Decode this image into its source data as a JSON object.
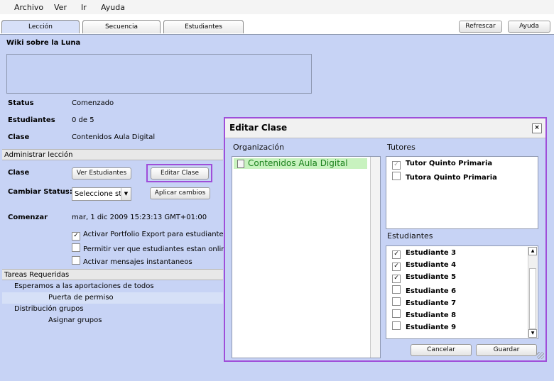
{
  "menu": [
    "Archivo",
    "Ver",
    "Ir",
    "Ayuda"
  ],
  "tabs": [
    "Lección",
    "Secuencia",
    "Estudiantes"
  ],
  "toolbar": {
    "refresh": "Refrescar",
    "help": "Ayuda"
  },
  "lesson": {
    "title": "Wiki sobre la Luna",
    "status_label": "Status",
    "status_value": "Comenzado",
    "students_label": "Estudiantes",
    "students_value": "0 de 5",
    "class_label": "Clase",
    "class_value": "Contenidos Aula Digital"
  },
  "admin": {
    "section": "Administrar lección",
    "class_label": "Clase",
    "view_students": "Ver Estudiantes",
    "edit_class": "Editar Clase",
    "change_status_label": "Cambiar Status:",
    "select_value": "Seleccione st",
    "apply": "Aplicar cambios",
    "start_label": "Comenzar",
    "start_value": "mar, 1 dic 2009 15:23:13 GMT+01:00",
    "options": [
      {
        "label": "Activar Portfolio Export para estudiantes",
        "checked": true
      },
      {
        "label": "Permitir ver que estudiantes estan online",
        "checked": false
      },
      {
        "label": "Activar mensajes instantaneos",
        "checked": false
      }
    ]
  },
  "tasks": {
    "section": "Tareas Requeridas",
    "items": [
      "Esperamos a las aportaciones de todos",
      "Puerta de permiso",
      "Distribución grupos",
      "Asignar grupos"
    ]
  },
  "dialog": {
    "title": "Editar Clase",
    "close": "×",
    "org_label": "Organización",
    "org_item": "Contenidos Aula Digital",
    "tutors_label": "Tutores",
    "tutors": [
      {
        "name": "Tutor Quinto Primaria",
        "checked": true
      },
      {
        "name": "Tutora Quinto Primaria",
        "checked": false
      }
    ],
    "students_label": "Estudiantes",
    "students": [
      {
        "name": "Estudiante 3",
        "checked": true
      },
      {
        "name": "Estudiante 4",
        "checked": true
      },
      {
        "name": "Estudiante 5",
        "checked": true
      },
      {
        "name": "Estudiante 6",
        "checked": false
      },
      {
        "name": "Estudiante 7",
        "checked": false
      },
      {
        "name": "Estudiante 8",
        "checked": false
      },
      {
        "name": "Estudiante 9",
        "checked": false
      }
    ],
    "cancel": "Cancelar",
    "save": "Guardar"
  },
  "icons": {
    "check": "✓",
    "dropdown": "▼",
    "scroll_up": "▲",
    "scroll_down": "▼"
  },
  "colors": {
    "background": "#c7d3f5",
    "dialog_border": "#9f4ed9",
    "org_selected_bg": "#c8f2bf",
    "org_selected_text": "#19801b"
  }
}
